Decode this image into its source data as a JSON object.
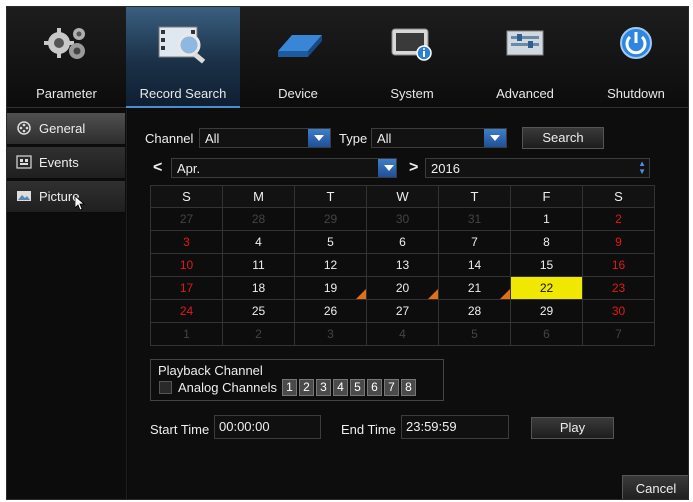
{
  "topnav": {
    "items": [
      {
        "label": "Parameter",
        "icon": "gears-icon"
      },
      {
        "label": "Record Search",
        "icon": "film-search-icon"
      },
      {
        "label": "Device",
        "icon": "hard-disk-icon"
      },
      {
        "label": "System",
        "icon": "system-info-icon"
      },
      {
        "label": "Advanced",
        "icon": "advanced-settings-icon"
      },
      {
        "label": "Shutdown",
        "icon": "power-icon"
      }
    ],
    "active": "Record Search"
  },
  "sidebar": {
    "items": [
      {
        "label": "General",
        "icon": "film-reel-icon"
      },
      {
        "label": "Events",
        "icon": "events-icon"
      },
      {
        "label": "Picture",
        "icon": "picture-icon"
      }
    ],
    "active": "General"
  },
  "filters": {
    "channel_label": "Channel",
    "channel_value": "All",
    "type_label": "Type",
    "type_value": "All",
    "search_label": "Search"
  },
  "month_nav": {
    "prev_symbol": "<",
    "month": "Apr.",
    "next_symbol": ">",
    "year": "2016"
  },
  "calendar": {
    "weekdays": [
      "S",
      "M",
      "T",
      "W",
      "T",
      "F",
      "S"
    ],
    "weeks": [
      [
        "27",
        "28",
        "29",
        "30",
        "31",
        "1",
        "2"
      ],
      [
        "3",
        "4",
        "5",
        "6",
        "7",
        "8",
        "9"
      ],
      [
        "10",
        "11",
        "12",
        "13",
        "14",
        "15",
        "16"
      ],
      [
        "17",
        "18",
        "19",
        "20",
        "21",
        "22",
        "23"
      ],
      [
        "24",
        "25",
        "26",
        "27",
        "28",
        "29",
        "30"
      ],
      [
        "1",
        "2",
        "3",
        "4",
        "5",
        "6",
        "7"
      ]
    ],
    "selected_day": "22",
    "recorded_days": [
      "19",
      "20",
      "21"
    ],
    "colors": {
      "weekend": "#e01818",
      "selected": "#f0e800",
      "record_marker": "#e07018"
    }
  },
  "playback": {
    "title": "Playback Channel",
    "analog_label": "Analog Channels",
    "channels": [
      "1",
      "2",
      "3",
      "4",
      "5",
      "6",
      "7",
      "8"
    ]
  },
  "time": {
    "start_label": "Start Time",
    "start_value": "00:00:00",
    "end_label": "End Time",
    "end_value": "23:59:59",
    "play_label": "Play"
  },
  "cancel_label": "Cancel"
}
